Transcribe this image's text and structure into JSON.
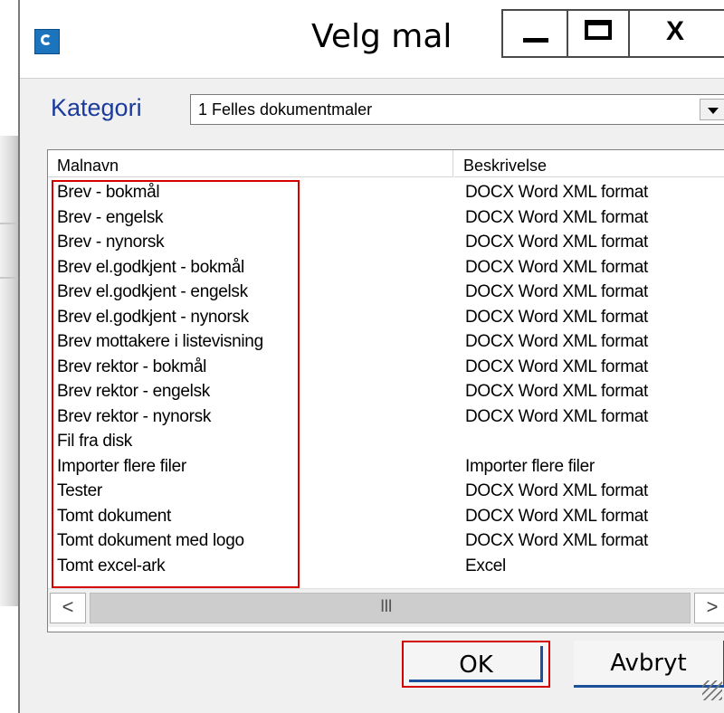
{
  "window": {
    "title": "Velg mal"
  },
  "kategori": {
    "label": "Kategori",
    "selected": "1 Felles dokumentmaler"
  },
  "list": {
    "columns": [
      "Malnavn",
      "Beskrivelse"
    ],
    "rows": [
      {
        "name": "Brev - bokmål",
        "desc": "DOCX Word XML format"
      },
      {
        "name": "Brev - engelsk",
        "desc": "DOCX Word XML format"
      },
      {
        "name": "Brev - nynorsk",
        "desc": "DOCX Word XML format"
      },
      {
        "name": "Brev el.godkjent - bokmål",
        "desc": "DOCX Word XML format"
      },
      {
        "name": "Brev el.godkjent - engelsk",
        "desc": "DOCX Word XML format"
      },
      {
        "name": "Brev el.godkjent - nynorsk",
        "desc": "DOCX Word XML format"
      },
      {
        "name": "Brev mottakere i listevisning",
        "desc": "DOCX Word XML format"
      },
      {
        "name": "Brev rektor - bokmål",
        "desc": "DOCX Word XML format"
      },
      {
        "name": "Brev rektor - engelsk",
        "desc": "DOCX Word XML format"
      },
      {
        "name": "Brev rektor - nynorsk",
        "desc": "DOCX Word XML format"
      },
      {
        "name": "Fil fra disk",
        "desc": ""
      },
      {
        "name": "Importer flere filer",
        "desc": "Importer flere filer"
      },
      {
        "name": "Tester",
        "desc": "DOCX Word XML format"
      },
      {
        "name": "Tomt dokument",
        "desc": "DOCX Word XML format"
      },
      {
        "name": "Tomt dokument med logo",
        "desc": "DOCX Word XML format"
      },
      {
        "name": "Tomt excel-ark",
        "desc": "Excel"
      }
    ]
  },
  "scrollbar": {
    "left": "<",
    "right": ">",
    "grip": "III"
  },
  "buttons": {
    "ok": "OK",
    "cancel": "Avbryt"
  },
  "icons": {
    "app": "app-e-icon",
    "minimize": "minimize-icon",
    "maximize": "maximize-icon",
    "close": "close-icon",
    "dropdown": "chevron-down-icon"
  },
  "highlight_color": "#d40000"
}
